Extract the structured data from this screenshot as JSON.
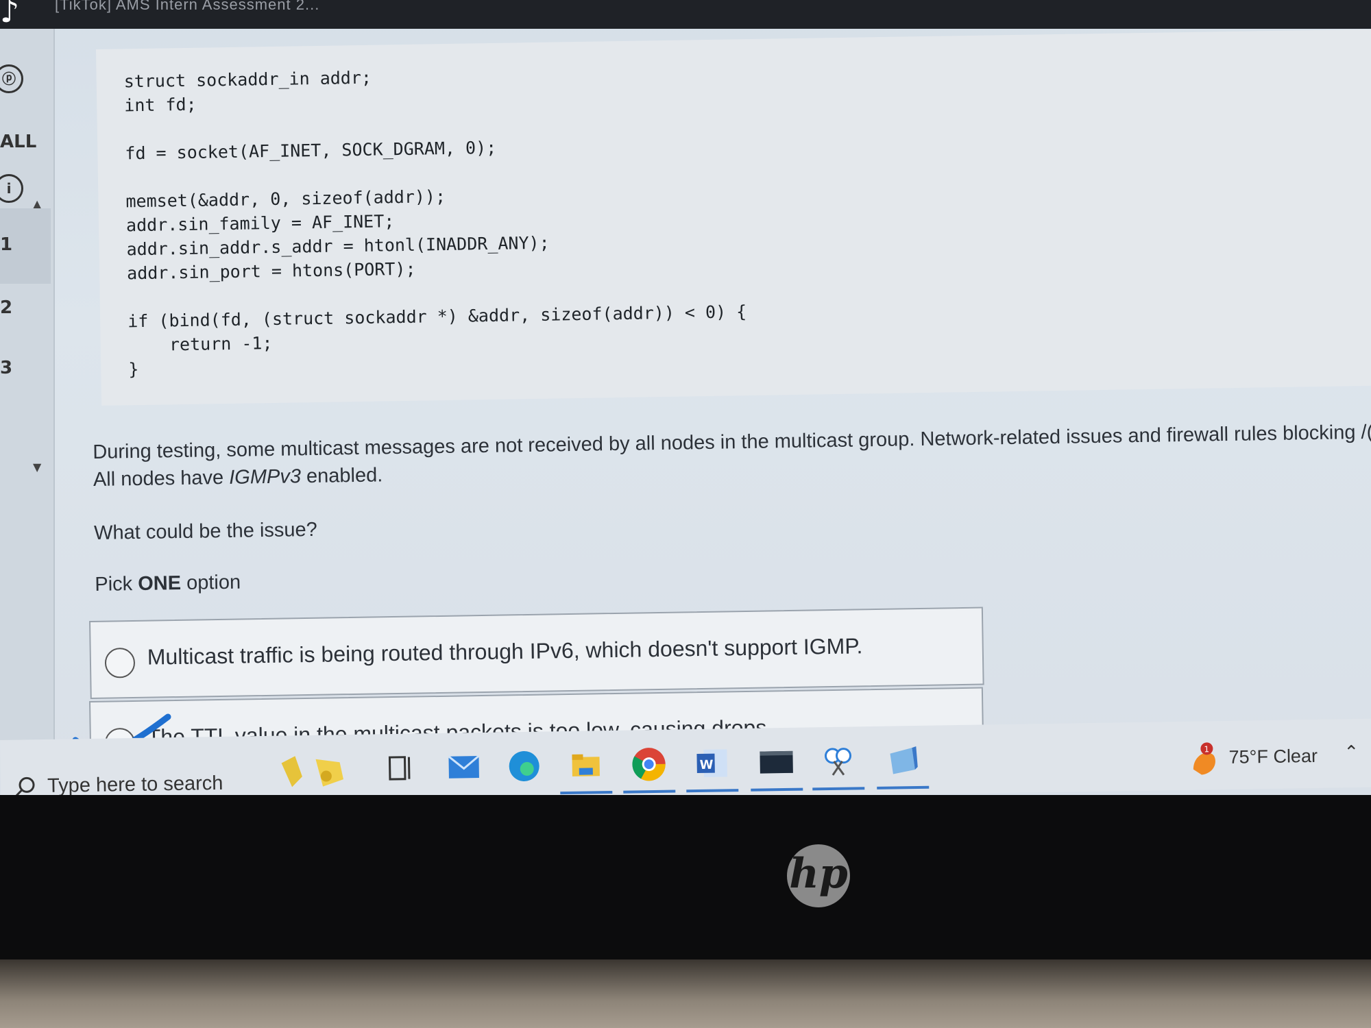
{
  "window": {
    "title": "[TikTok] AMS Intern Assessment 2..."
  },
  "left_rail": {
    "items": [
      "ALL",
      "1",
      "2",
      "3"
    ]
  },
  "code": {
    "lines": [
      "struct sockaddr_in addr;",
      "int fd;",
      "",
      "fd = socket(AF_INET, SOCK_DGRAM, 0);",
      "",
      "memset(&addr, 0, sizeof(addr));",
      "addr.sin_family = AF_INET;",
      "addr.sin_addr.s_addr = htonl(INADDR_ANY);",
      "addr.sin_port = htons(PORT);",
      "",
      "if (bind(fd, (struct sockaddr *) &addr, sizeof(addr)) < 0) {",
      "    return -1;",
      "}"
    ]
  },
  "question": {
    "line1": "During testing, some multicast messages are not received by all nodes in the multicast group. Network-related issues and firewall rules blocking /(",
    "line2_prefix": "All nodes have ",
    "line2_italic": "IGMPv3",
    "line2_suffix": " enabled.",
    "prompt": "What could be the issue?",
    "pick_prefix": "Pick ",
    "pick_bold": "ONE",
    "pick_suffix": " option"
  },
  "options": [
    {
      "label": "Multicast traffic is being routed through IPv6, which doesn't support IGMP."
    },
    {
      "label": "The TTL value in the multicast packets is too low, causing drops."
    }
  ],
  "taskbar": {
    "search_placeholder": "Type here to search",
    "icons": [
      "widgets-icon",
      "task-view-icon",
      "mail-icon",
      "edge-icon",
      "file-explorer-icon",
      "chrome-icon",
      "word-icon",
      "terminal-icon",
      "snipping-tool-icon",
      "notepad-icon"
    ],
    "weather": "75°F  Clear",
    "weather_badge": "1"
  },
  "hardware": {
    "logo": "hp"
  }
}
